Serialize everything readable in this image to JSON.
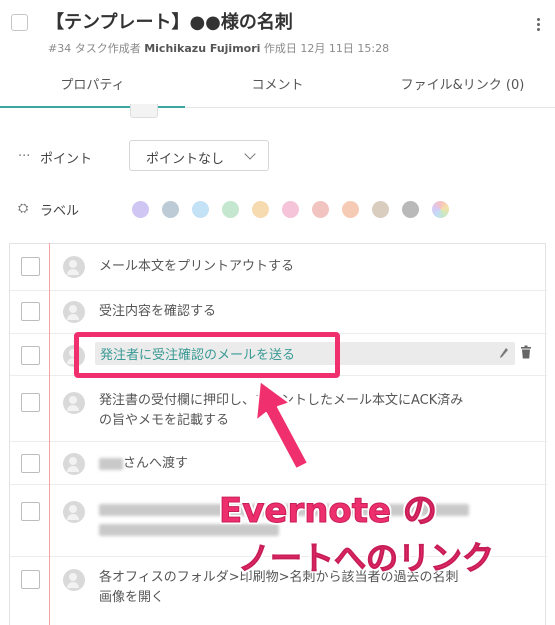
{
  "header": {
    "title": "【テンプレート】●●様の名刺",
    "meta_id": "#34",
    "meta_created_by": "タスク作成者",
    "meta_author": "Michikazu Fujimori",
    "meta_created_on": "作成日 12月 11日 15:28"
  },
  "tabs": [
    {
      "label": "プロパティ",
      "active": true
    },
    {
      "label": "コメント",
      "active": false
    },
    {
      "label": "ファイル&リンク (0)",
      "active": false
    }
  ],
  "properties": {
    "point_icon": "···",
    "point_label": "ポイント",
    "point_value": "ポイントなし",
    "label_icon": "⛭",
    "label_label": "ラベル",
    "label_colors": [
      "#cfc6f3",
      "#bccbd6",
      "#c3e2f6",
      "#c5e6cf",
      "#f6dbb0",
      "#f5c4d8",
      "#f1c4c1",
      "#f6cbb6",
      "#d9cdc0",
      "#b9b9b9",
      "multicolor"
    ]
  },
  "checklist": {
    "items": [
      {
        "text": "メール本文をプリントアウトする"
      },
      {
        "text": "受注内容を確認する"
      },
      {
        "text": "発注者に受注確認のメールを送る",
        "editing": true
      },
      {
        "text_line1": "発注書の受付欄に押印し、プリントしたメール本文にACK済み",
        "text_line2": "の旨やメモを記載する"
      },
      {
        "text": "さんへ渡す"
      },
      {
        "redacted": true
      },
      {
        "text_line1": "各オフィスのフォルダ>印刷物>名刺から該当者の過去の名刺",
        "text_line2": "画像を開く"
      }
    ]
  },
  "annotation": {
    "line1": "Evernote の",
    "line2": "ノートへのリンク",
    "color": "#f0306e"
  }
}
